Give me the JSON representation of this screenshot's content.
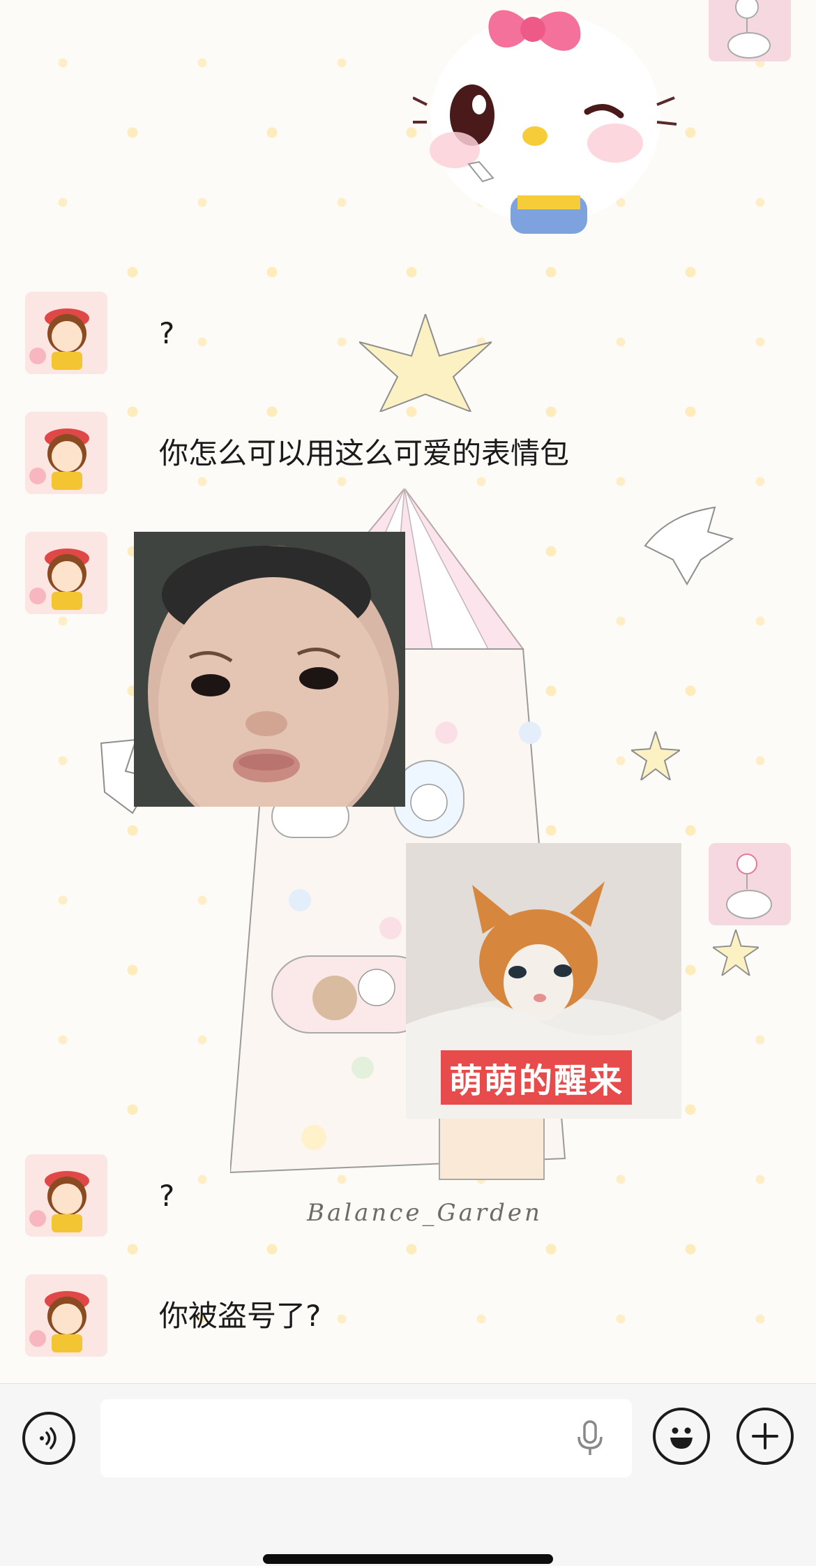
{
  "messages": [
    {
      "sender": "friend",
      "text": "?"
    },
    {
      "sender": "friend",
      "text": "你怎么可以用这么可爱的表情包"
    },
    {
      "sender": "friend",
      "type": "sticker",
      "sticker": "pouting-baby"
    },
    {
      "sender": "me",
      "type": "sticker",
      "sticker": "kitten",
      "caption": "萌萌的醒来"
    },
    {
      "sender": "friend",
      "text": "?"
    },
    {
      "sender": "friend",
      "text": "你被盗号了?"
    }
  ],
  "background": {
    "watermark": "Balance_Garden"
  },
  "input_bar": {
    "voice_icon": "voice-icon",
    "mic_icon": "microphone-icon",
    "emoji_icon": "emoji-icon",
    "plus_icon": "plus-icon"
  },
  "colors": {
    "caption_bg": "#e74b4b",
    "avatar_bg": "#f4cfd3"
  }
}
